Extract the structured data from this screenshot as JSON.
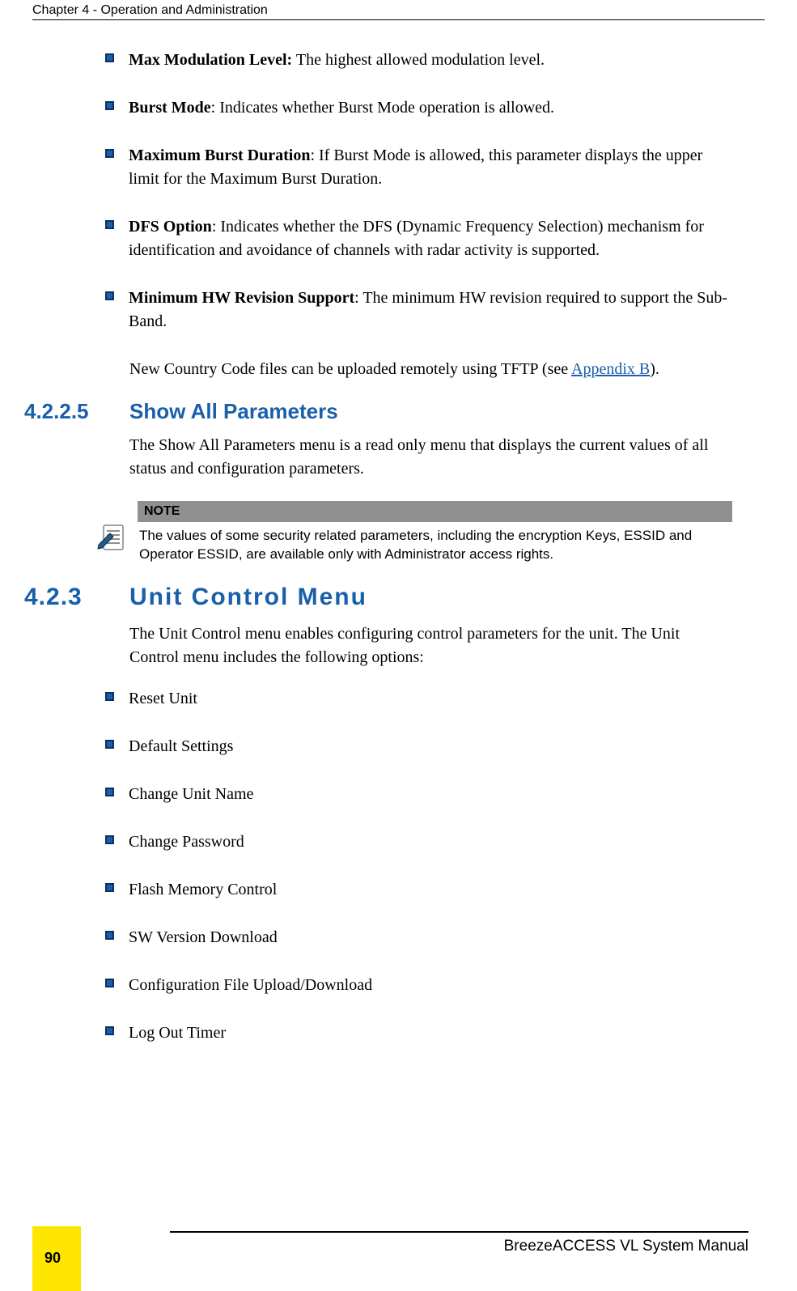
{
  "header": {
    "chapter": "Chapter 4 - Operation and Administration"
  },
  "defs": [
    {
      "term": "Max Modulation Level:",
      "text": " The highest allowed modulation level."
    },
    {
      "term": "Burst Mode",
      "text": ": Indicates whether Burst Mode operation is allowed."
    },
    {
      "term": "Maximum Burst Duration",
      "text": ": If Burst Mode is allowed, this parameter displays the upper limit for the Maximum Burst Duration."
    },
    {
      "term": "DFS Option",
      "text": ": Indicates whether the DFS (Dynamic Frequency Selection) mechanism for identification and avoidance of channels with radar activity is supported."
    },
    {
      "term": "Minimum HW Revision Support",
      "text": ": The minimum HW revision required to support the Sub-Band."
    }
  ],
  "country_code_para": {
    "pre": "New Country Code files can be uploaded remotely using TFTP (see ",
    "link": "Appendix B",
    "post": ")."
  },
  "sect_4225": {
    "num": "4.2.2.5",
    "title": "Show All Parameters",
    "body": "The Show All Parameters menu is a read only menu that displays the current values of all status and configuration parameters."
  },
  "note": {
    "label": "NOTE",
    "body": "The values of some security related parameters, including the encryption Keys, ESSID and Operator ESSID, are available only with Administrator access rights."
  },
  "sect_423": {
    "num": "4.2.3",
    "title": "Unit Control Menu",
    "body": "The Unit Control menu enables configuring control parameters for the unit. The Unit Control menu includes the following options:"
  },
  "menu_items": [
    "Reset Unit",
    "Default Settings",
    "Change Unit Name",
    "Change Password",
    "Flash Memory Control",
    "SW Version Download",
    "Configuration File Upload/Download",
    "Log Out Timer"
  ],
  "footer": {
    "manual": "BreezeACCESS VL System Manual",
    "page": "90"
  }
}
